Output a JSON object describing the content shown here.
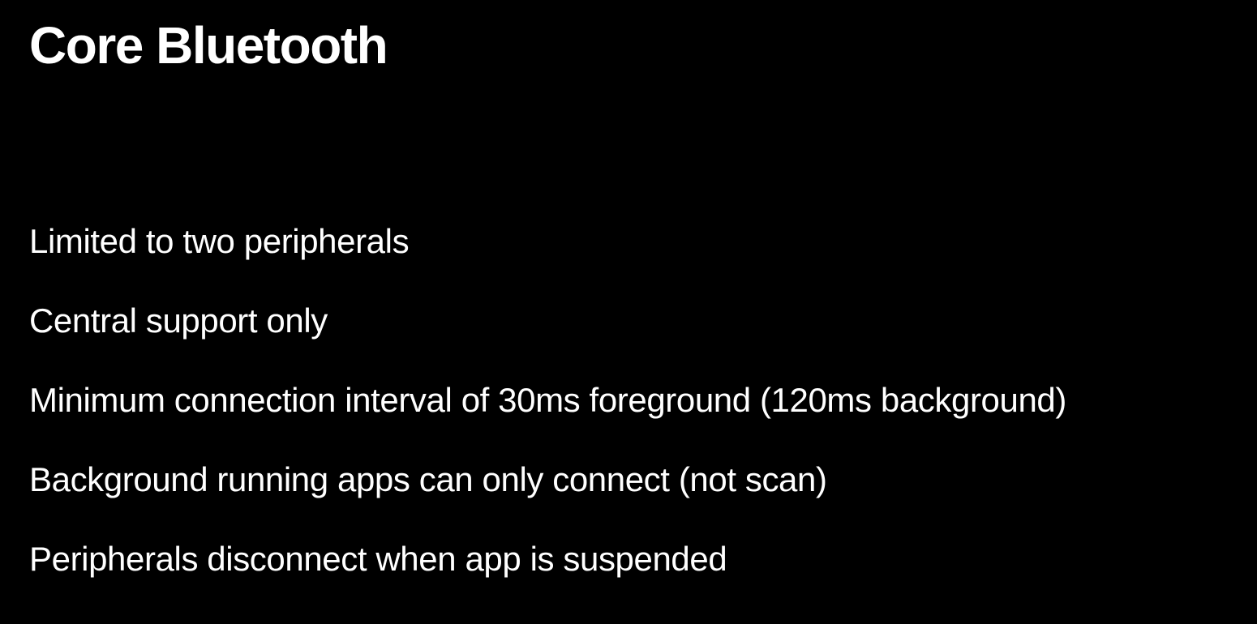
{
  "slide": {
    "title": "Core Bluetooth",
    "bullets": [
      "Limited to two peripherals",
      "Central support only",
      "Minimum connection interval of 30ms foreground (120ms background)",
      "Background running apps can only connect (not scan)",
      "Peripherals disconnect when app is suspended"
    ]
  }
}
